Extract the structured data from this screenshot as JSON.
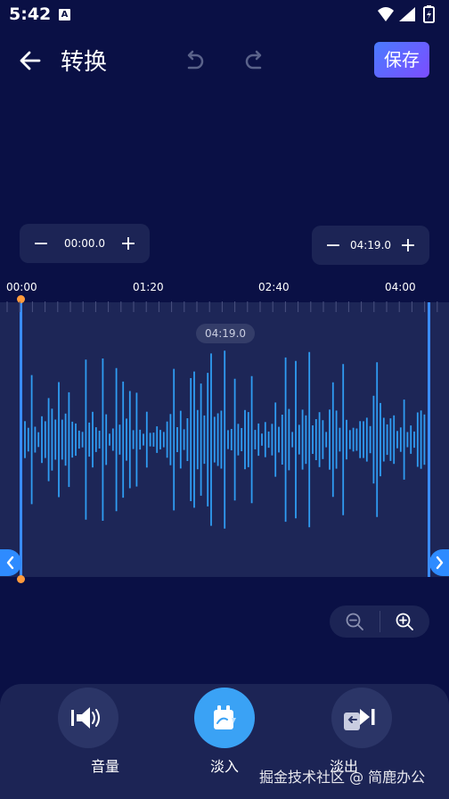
{
  "status_bar": {
    "time": "5:42",
    "notification_badge": "A"
  },
  "toolbar": {
    "title": "转换",
    "save_label": "保存"
  },
  "start_time": {
    "value": "00:00.0",
    "minus": "−",
    "plus": "+"
  },
  "end_time": {
    "value": "04:19.0",
    "minus": "−",
    "plus": "+"
  },
  "ruler": {
    "ticks": [
      "00:00",
      "01:20",
      "02:40",
      "04:00"
    ]
  },
  "waveform": {
    "duration_badge": "04:19.0"
  },
  "tools": [
    {
      "label": "音量",
      "icon": "volume-icon"
    },
    {
      "label": "淡入",
      "icon": "fade-in-icon"
    },
    {
      "label": "淡出",
      "icon": "fade-out-icon"
    }
  ],
  "watermark": "掘金技术社区 @ 简鹿办公",
  "colors": {
    "background": "#0a1045",
    "panel": "#1c2455",
    "accent": "#3a8cff",
    "marker": "#ff9a3c"
  }
}
